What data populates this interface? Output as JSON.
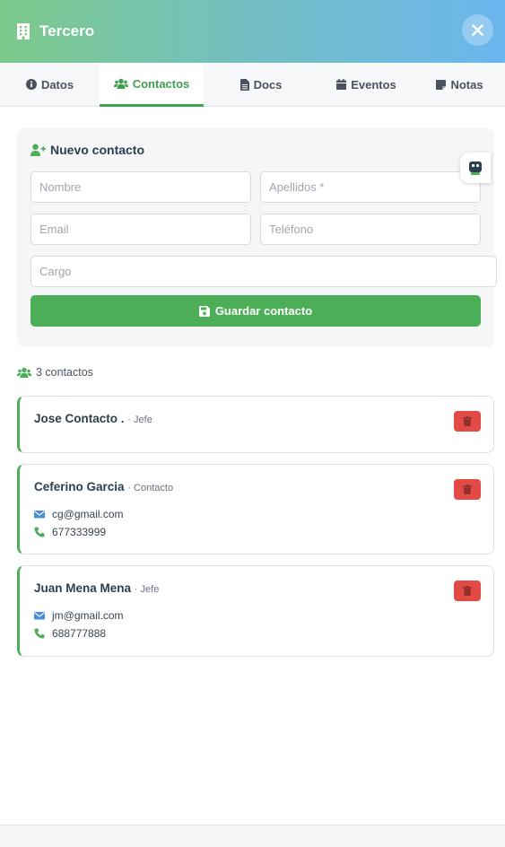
{
  "header": {
    "title": "Tercero",
    "icon": "building-icon"
  },
  "tabs": [
    {
      "label": "Datos",
      "icon": "info-circle-icon"
    },
    {
      "label": "Contactos",
      "icon": "users-icon"
    },
    {
      "label": "Docs",
      "icon": "file-icon"
    },
    {
      "label": "Eventos",
      "icon": "calendar-icon"
    },
    {
      "label": "Notas",
      "icon": "sticky-note-icon"
    }
  ],
  "form": {
    "title": "Nuevo contacto",
    "nombre_placeholder": "Nombre",
    "apellidos_placeholder": "Apellidos *",
    "email_placeholder": "Email",
    "telefono_placeholder": "Teléfono",
    "cargo_placeholder": "Cargo",
    "save_label": "Guardar contacto"
  },
  "count_label": "3 contactos",
  "contacts": [
    {
      "name": "Jose Contacto .",
      "role": "· Jefe",
      "email": "",
      "phone": ""
    },
    {
      "name": "Ceferino Garcia",
      "role": "· Contacto",
      "email": "cg@gmail.com",
      "phone": "677333999"
    },
    {
      "name": "Juan Mena Mena",
      "role": "· Jefe",
      "email": "jm@gmail.com",
      "phone": "688777888"
    }
  ],
  "colors": {
    "accent": "#4caf57",
    "delete": "#e24b45",
    "email_icon": "#4a90d9",
    "phone_icon": "#4caf57"
  }
}
